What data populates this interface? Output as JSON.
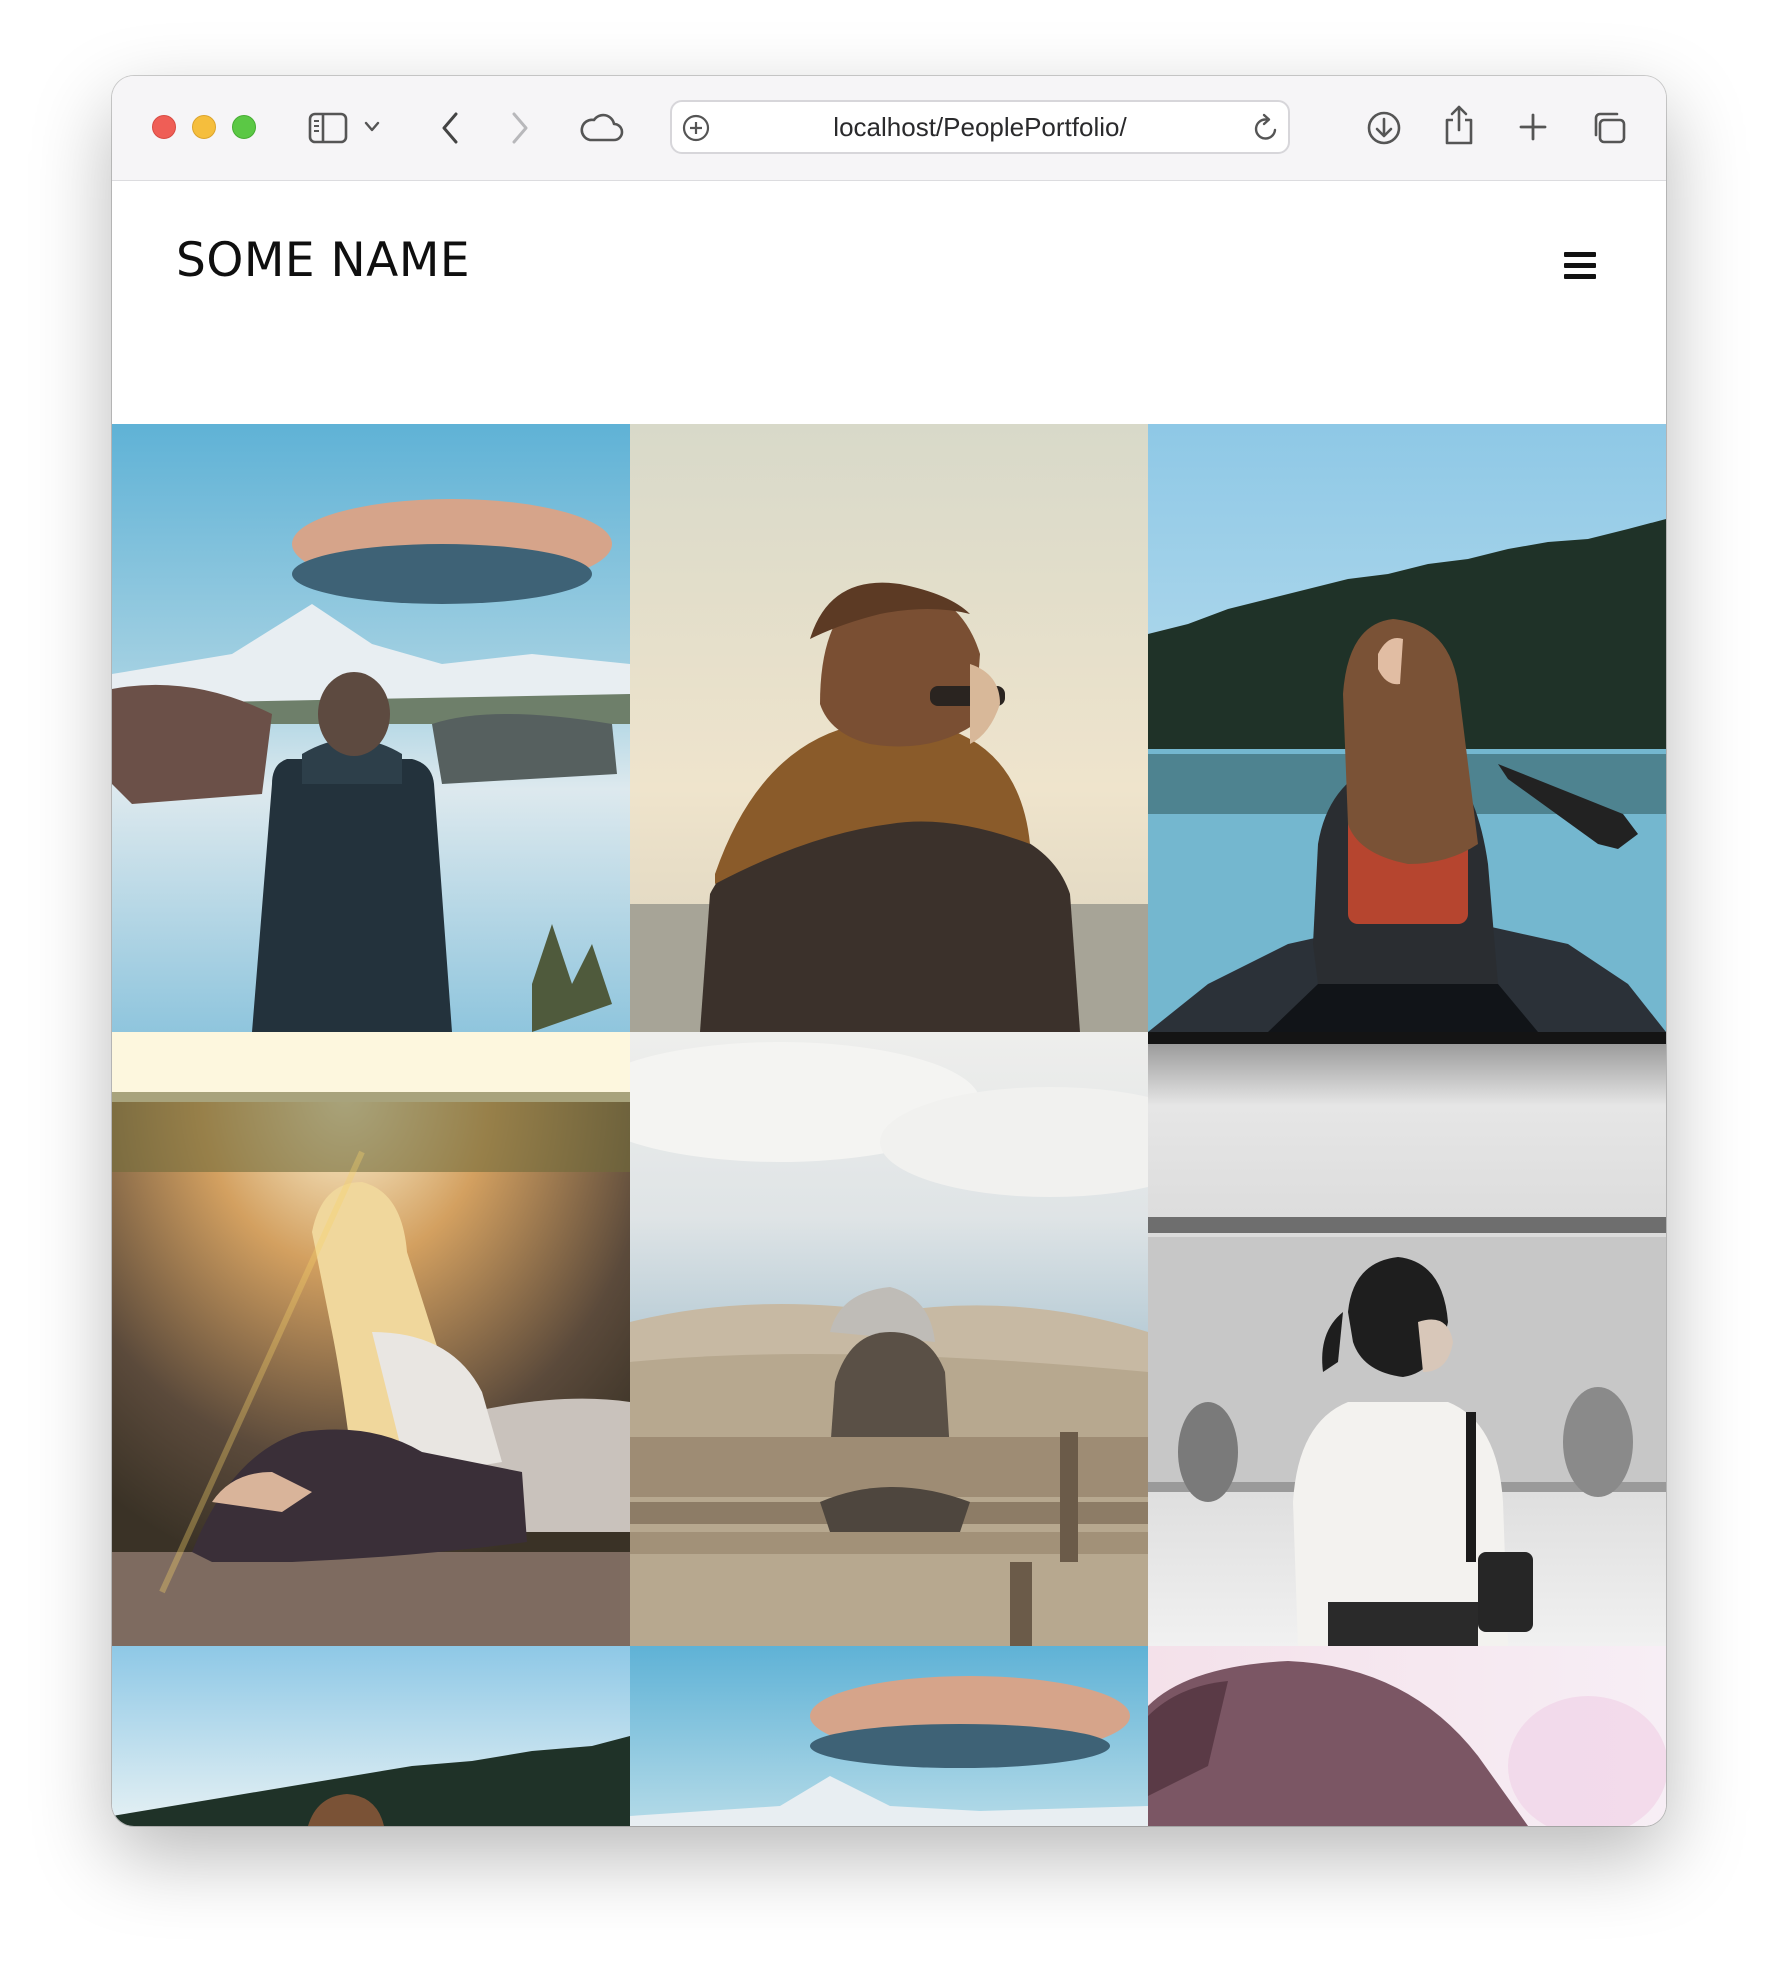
{
  "browser": {
    "url": "localhost/PeoplePortfolio/",
    "icons": [
      "sidebar-icon",
      "chevron-down-icon",
      "back-icon",
      "forward-icon",
      "cloud-icon",
      "site-settings-icon",
      "reload-icon",
      "download-icon",
      "share-icon",
      "new-tab-icon",
      "tabs-overview-icon"
    ]
  },
  "site": {
    "title": "SOME NAME",
    "menu_icon": "hamburger-menu-icon"
  },
  "gallery": {
    "photos": [
      "man-puffer-jacket-mountain-lake",
      "person-scarf-sunglasses",
      "woman-canoe-forest-lake",
      "woman-sunlight-sitting-cliff",
      "person-bench-dunes",
      "woman-subway-station",
      "canoe-forest-lake-cropped",
      "cloud-mountain-cropped",
      "head-closeup-pink-light"
    ]
  }
}
